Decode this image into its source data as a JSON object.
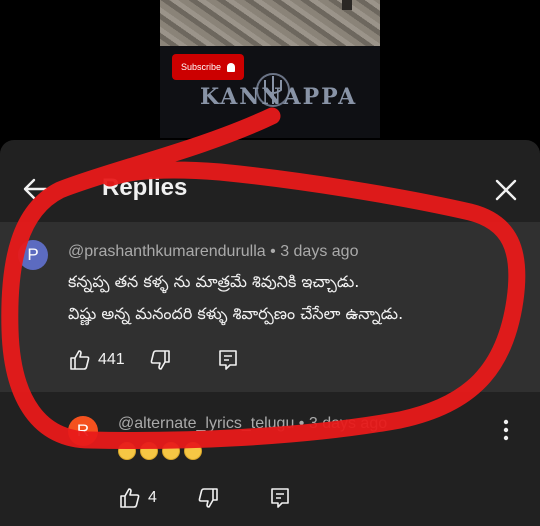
{
  "video": {
    "subscribe_label": "Subscribe",
    "logo_text": "KANNAPPA"
  },
  "panel": {
    "title": "Replies"
  },
  "parent_comment": {
    "avatar_letter": "P",
    "avatar_color": "#5c6bc0",
    "author": "@prashanthkumarendurulla",
    "time": "3 days ago",
    "line1": "కన్నప్ప  తన కళ్ళ ను మాత్రమే శివునికి ఇచ్చాడు.",
    "line2": "విష్ణు అన్న మనందరి కళ్ళు శివార్పణం చేసేలా ఉన్నాడు.",
    "likes": "441"
  },
  "reply_comment": {
    "avatar_letter": "R",
    "avatar_color": "#f4511e",
    "author": "@alternate_lyrics_telugu",
    "time": "3 days ago",
    "likes": "4"
  },
  "colors": {
    "panel_bg": "#212121",
    "highlight_bg": "#303030",
    "annotation_stroke": "#e81a1a"
  }
}
